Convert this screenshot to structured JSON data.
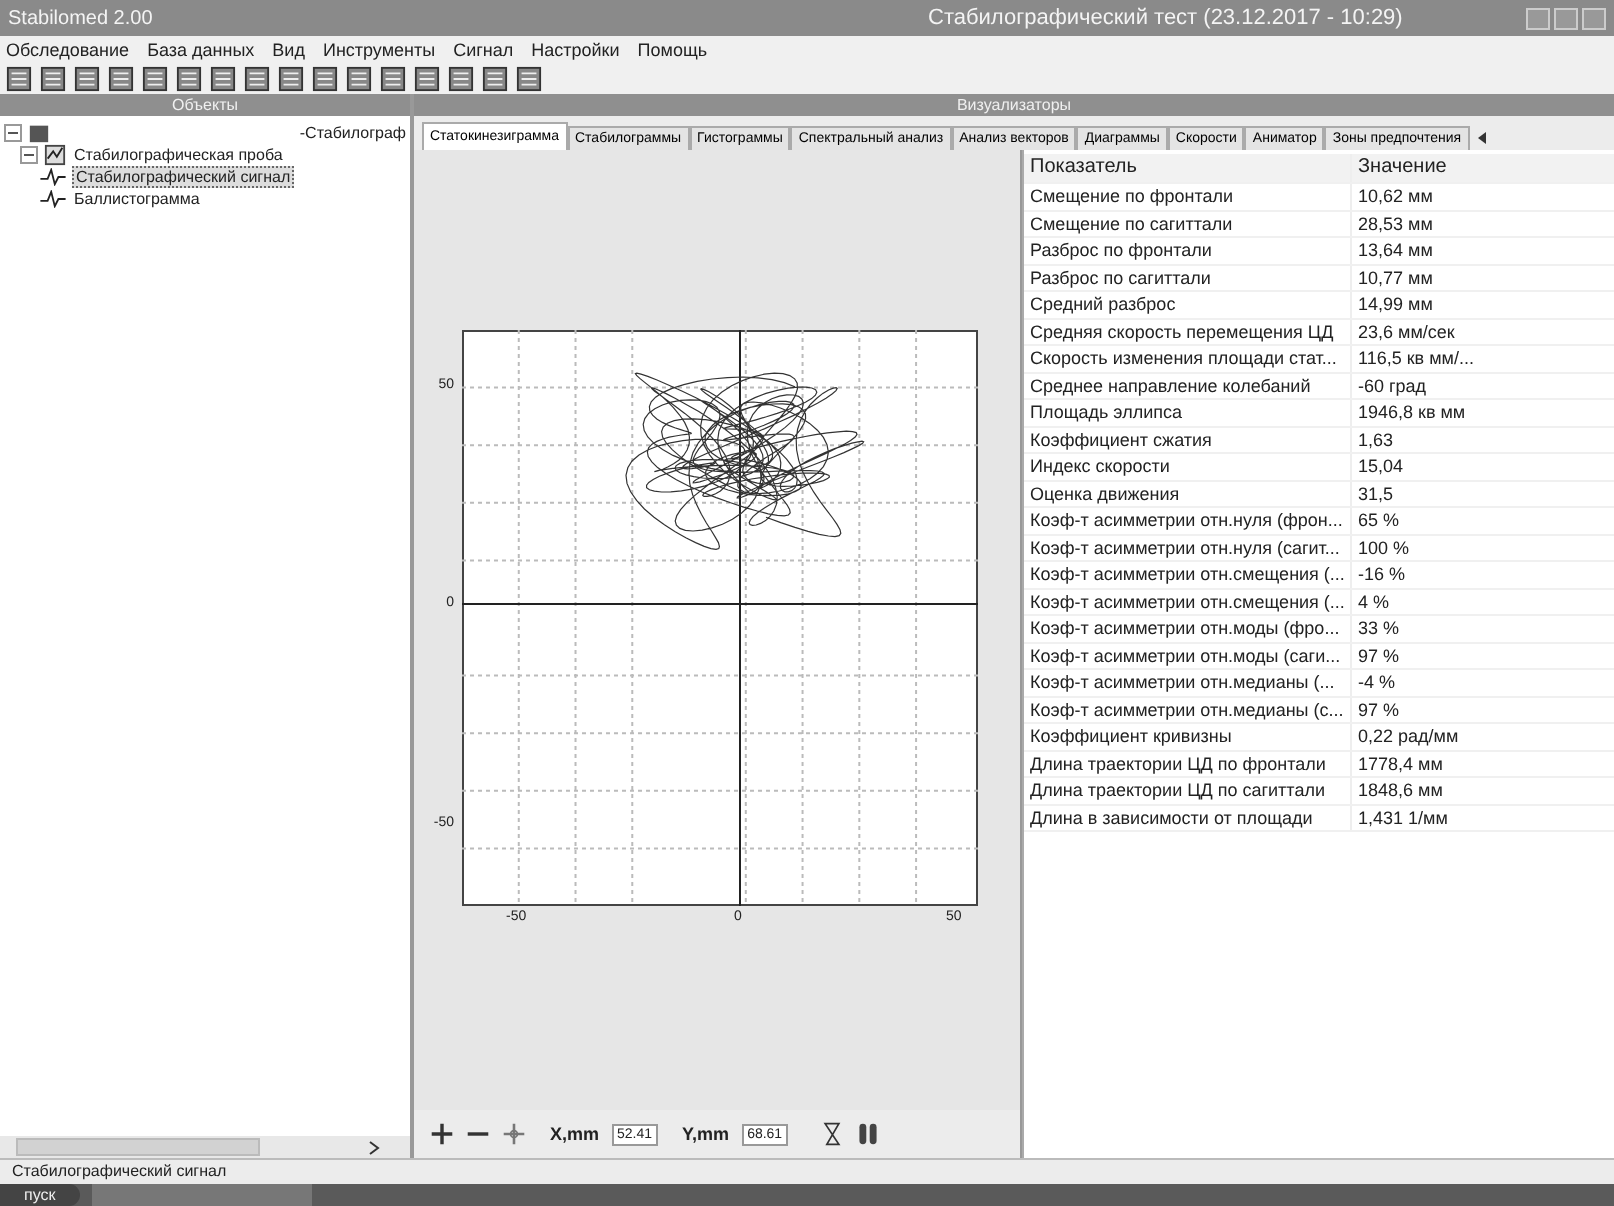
{
  "window": {
    "app": "Stabilomed 2.00",
    "title": "Стабилографический тест (23.12.2017 - 10:29)"
  },
  "menu": [
    "Обследование",
    "База данных",
    "Вид",
    "Инструменты",
    "Сигнал",
    "Настройки",
    "Помощь"
  ],
  "objects_panel": {
    "title": "Объекты",
    "root_label": "-Стабилограф",
    "tree": [
      {
        "label": "Стабилографическая проба",
        "expanded": true,
        "selected": false,
        "children": [
          {
            "label": "Стабилографический сигнал",
            "selected": true
          },
          {
            "label": "Баллистограмма",
            "selected": false
          }
        ]
      }
    ]
  },
  "visualizers_panel": {
    "title": "Визуализаторы"
  },
  "tabs": [
    {
      "label": "Статокинезиграмма",
      "selected": true
    },
    {
      "label": "Стабилограммы",
      "selected": false
    },
    {
      "label": "Гистограммы",
      "selected": false
    },
    {
      "label": "Спектральный анализ",
      "selected": false
    },
    {
      "label": "Анализ векторов",
      "selected": false
    },
    {
      "label": "Диаграммы",
      "selected": false
    },
    {
      "label": "Скорости",
      "selected": false
    },
    {
      "label": "Аниматор",
      "selected": false
    },
    {
      "label": "Зоны предпочтения",
      "selected": false
    }
  ],
  "plot": {
    "x_ticks": [
      "-50",
      "0",
      "50"
    ],
    "y_ticks": [
      "50",
      "0",
      "-50"
    ]
  },
  "table": {
    "columns": [
      "Показатель",
      "Значение"
    ],
    "rows": [
      [
        "Смещение по фронтали",
        "10,62 мм"
      ],
      [
        "Смещение по сагиттали",
        "28,53 мм"
      ],
      [
        "Разброс по фронтали",
        "13,64 мм"
      ],
      [
        "Разброс по сагиттали",
        "10,77 мм"
      ],
      [
        "Средний разброс",
        "14,99 мм"
      ],
      [
        "Средняя скорость перемещения ЦД",
        "23,6 мм/сек"
      ],
      [
        "Скорость изменения площади стат...",
        "116,5 кв мм/..."
      ],
      [
        "Среднее направление колебаний",
        "-60 град"
      ],
      [
        "Площадь эллипса",
        "1946,8 кв мм"
      ],
      [
        "Коэффициент сжатия",
        "1,63"
      ],
      [
        "Индекс скорости",
        "15,04"
      ],
      [
        "Оценка движения",
        "31,5"
      ],
      [
        "Коэф-т асимметрии отн.нуля (фрон...",
        "65 %"
      ],
      [
        "Коэф-т асимметрии отн.нуля (сагит...",
        "100 %"
      ],
      [
        "Коэф-т асимметрии отн.смещения (...",
        "-16 %"
      ],
      [
        "Коэф-т асимметрии отн.смещения (...",
        "4 %"
      ],
      [
        "Коэф-т асимметрии отн.моды (фро...",
        "33 %"
      ],
      [
        "Коэф-т асимметрии отн.моды (саги...",
        "97 %"
      ],
      [
        "Коэф-т асимметрии отн.медианы (...",
        "-4 %"
      ],
      [
        "Коэф-т асимметрии отн.медианы (с...",
        "97 %"
      ],
      [
        "Коэффициент кривизны",
        "0,22 рад/мм"
      ],
      [
        "Длина траектории ЦД по фронтали",
        "1778,4 мм"
      ],
      [
        "Длина траектории ЦД по сагиттали",
        "1848,6 мм"
      ],
      [
        "Длина в зависимости от площади",
        "1,431 1/мм"
      ]
    ]
  },
  "coords": {
    "x_label": "X,mm",
    "x_value": "52.41",
    "y_label": "Y,mm",
    "y_value": "68.61"
  },
  "status_bar": "Стабилографический сигнал",
  "taskbar": {
    "start": "пуск"
  }
}
